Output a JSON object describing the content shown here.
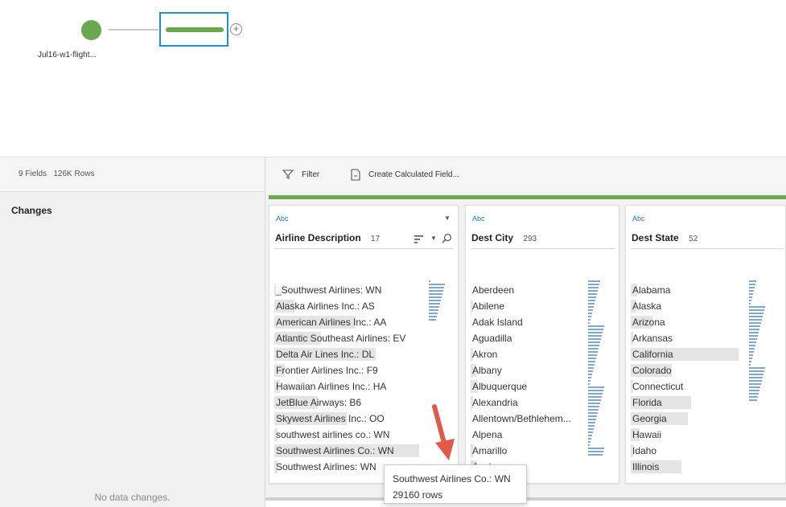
{
  "flow": {
    "input_label": "Jul16-w1-flight...",
    "add_symbol": "+",
    "colors": {
      "input": "#6aa84f",
      "step_border": "#1f8fd1",
      "step_bar": "#6aa84f"
    }
  },
  "sidebar": {
    "fields_label": "9 Fields",
    "rows_label": "126K Rows",
    "changes_title": "Changes",
    "no_changes": "No data changes."
  },
  "toolbar": {
    "filter_label": "Filter",
    "calc_label": "Create Calculated Field...",
    "filter_icon": "filter-icon",
    "calc_icon": "calc-icon"
  },
  "cards": [
    {
      "type": "Abc",
      "name": "Airline Description",
      "count": "17",
      "values": [
        {
          "label": "_Southwest Airlines: WN",
          "share": 0.01
        },
        {
          "label": "Alaska Airlines Inc.: AS",
          "share": 0.14
        },
        {
          "label": "American Airlines Inc.: AA",
          "share": 0.56
        },
        {
          "label": "Atlantic Southeast Airlines: EV",
          "share": 0.32
        },
        {
          "label": "Delta Air Lines Inc.: DL",
          "share": 0.7
        },
        {
          "label": "Frontier Airlines Inc.: F9",
          "share": 0.07
        },
        {
          "label": "Hawaiian Airlines Inc.: HA",
          "share": 0.04
        },
        {
          "label": "JetBlue Airways: B6",
          "share": 0.3
        },
        {
          "label": "Skywest Airlines Inc.: OO",
          "share": 0.5
        },
        {
          "label": "southwest airlines co.: WN",
          "share": 0.02
        },
        {
          "label": "Southwest Airlines Co.: WN",
          "share": 1.0
        },
        {
          "label": "Southwest Airlines: WN",
          "share": 0.02
        }
      ]
    },
    {
      "type": "Abc",
      "name": "Dest City",
      "count": "293",
      "values": [
        {
          "label": "Aberdeen",
          "share": 0.0
        },
        {
          "label": "Abilene",
          "share": 0.02
        },
        {
          "label": "Adak Island",
          "share": 0.0
        },
        {
          "label": "Aguadilla",
          "share": 0.0
        },
        {
          "label": "Akron",
          "share": 0.02
        },
        {
          "label": "Albany",
          "share": 0.05
        },
        {
          "label": "Albuquerque",
          "share": 0.07
        },
        {
          "label": "Alexandria",
          "share": 0.02
        },
        {
          "label": "Allentown/Bethlehem...",
          "share": 0.0
        },
        {
          "label": "Alpena",
          "share": 0.0
        },
        {
          "label": "Amarillo",
          "share": 0.03
        },
        {
          "label": "Anchorage",
          "share": 0.06
        }
      ]
    },
    {
      "type": "Abc",
      "name": "Dest State",
      "count": "52",
      "values": [
        {
          "label": "Alabama",
          "share": 0.06
        },
        {
          "label": "Alaska",
          "share": 0.05
        },
        {
          "label": "Arizona",
          "share": 0.2
        },
        {
          "label": "Arkansas",
          "share": 0.02
        },
        {
          "label": "California",
          "share": 1.0
        },
        {
          "label": "Colorado",
          "share": 0.38
        },
        {
          "label": "Connecticut",
          "share": 0.02
        },
        {
          "label": "Florida",
          "share": 0.56
        },
        {
          "label": "Georgia",
          "share": 0.53
        },
        {
          "label": "Hawaii",
          "share": 0.08
        },
        {
          "label": "Idaho",
          "share": 0.02
        },
        {
          "label": "Illinois",
          "share": 0.47
        }
      ]
    }
  ],
  "tooltip": {
    "title": "Southwest Airlines Co.: WN",
    "rows": "29160 rows"
  },
  "colors": {
    "accent": "#6aa84f",
    "arrow": "#e05a4a",
    "hist": "#7fa6cf"
  }
}
